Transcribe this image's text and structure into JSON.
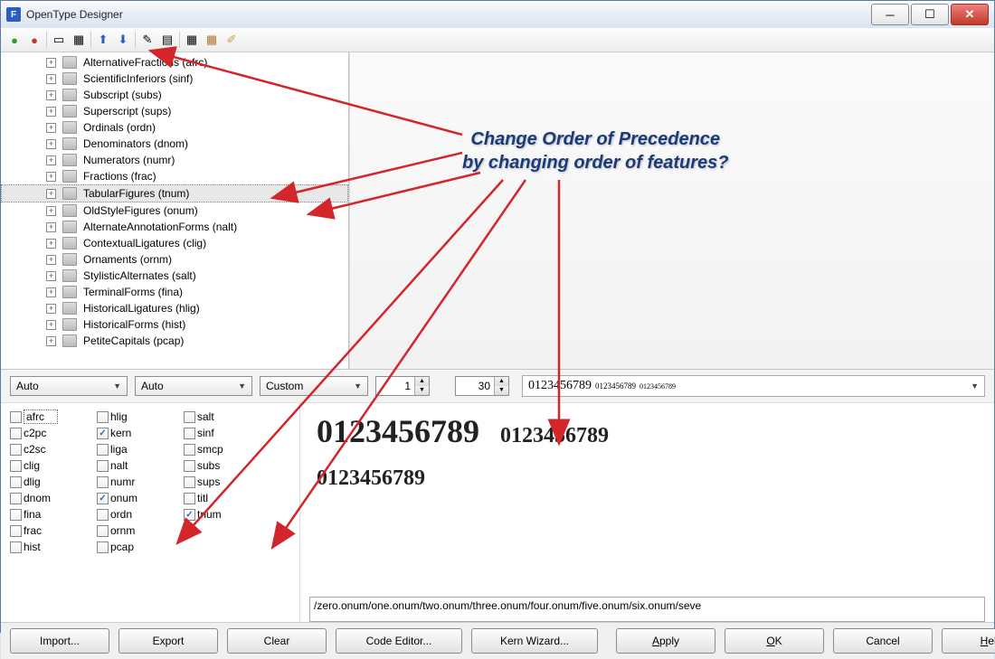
{
  "window": {
    "title": "OpenType Designer"
  },
  "tree": [
    {
      "label": "AlternativeFractions (afrc)",
      "sel": false
    },
    {
      "label": "ScientificInferiors (sinf)",
      "sel": false
    },
    {
      "label": "Subscript (subs)",
      "sel": false
    },
    {
      "label": "Superscript (sups)",
      "sel": false
    },
    {
      "label": "Ordinals (ordn)",
      "sel": false
    },
    {
      "label": "Denominators (dnom)",
      "sel": false
    },
    {
      "label": "Numerators (numr)",
      "sel": false
    },
    {
      "label": "Fractions (frac)",
      "sel": false
    },
    {
      "label": "TabularFigures (tnum)",
      "sel": true
    },
    {
      "label": "OldStyleFigures (onum)",
      "sel": false
    },
    {
      "label": "AlternateAnnotationForms (nalt)",
      "sel": false
    },
    {
      "label": "ContextualLigatures (clig)",
      "sel": false
    },
    {
      "label": "Ornaments (ornm)",
      "sel": false
    },
    {
      "label": "StylisticAlternates (salt)",
      "sel": false
    },
    {
      "label": "TerminalForms (fina)",
      "sel": false
    },
    {
      "label": "HistoricalLigatures (hlig)",
      "sel": false
    },
    {
      "label": "HistoricalForms (hist)",
      "sel": false
    },
    {
      "label": "PetiteCapitals (pcap)",
      "sel": false
    }
  ],
  "mid": {
    "combo1": "Auto",
    "combo2": "Auto",
    "combo3": "Custom",
    "spin1": "1",
    "spin2": "30",
    "previewline": {
      "big": "0123456789",
      "s1": "0123456789",
      "s2": "0123456789"
    }
  },
  "chkgrid": [
    [
      {
        "t": "afrc",
        "on": false,
        "focus": true
      },
      {
        "t": "hlig",
        "on": false
      },
      {
        "t": "salt",
        "on": false
      }
    ],
    [
      {
        "t": "c2pc",
        "on": false
      },
      {
        "t": "kern",
        "on": true
      },
      {
        "t": "sinf",
        "on": false
      }
    ],
    [
      {
        "t": "c2sc",
        "on": false
      },
      {
        "t": "liga",
        "on": false
      },
      {
        "t": "smcp",
        "on": false
      }
    ],
    [
      {
        "t": "clig",
        "on": false
      },
      {
        "t": "nalt",
        "on": false
      },
      {
        "t": "subs",
        "on": false
      }
    ],
    [
      {
        "t": "dlig",
        "on": false
      },
      {
        "t": "numr",
        "on": false
      },
      {
        "t": "sups",
        "on": false
      }
    ],
    [
      {
        "t": "dnom",
        "on": false
      },
      {
        "t": "onum",
        "on": true
      },
      {
        "t": "titl",
        "on": false
      }
    ],
    [
      {
        "t": "fina",
        "on": false
      },
      {
        "t": "ordn",
        "on": false
      },
      {
        "t": "tnum",
        "on": true
      }
    ],
    [
      {
        "t": "frac",
        "on": false
      },
      {
        "t": "ornm",
        "on": false
      },
      {
        "t": "",
        "on": false,
        "empty": true
      }
    ],
    [
      {
        "t": "hist",
        "on": false
      },
      {
        "t": "pcap",
        "on": false
      },
      {
        "t": "",
        "on": false,
        "empty": true
      }
    ]
  ],
  "preview": {
    "line1a": "0123456789",
    "line1b": "0123456789",
    "line2": "0123456789",
    "glyphs": "/zero.onum/one.onum/two.onum/three.onum/four.onum/five.onum/six.onum/seve"
  },
  "buttons": {
    "import": "Import...",
    "export": "Export",
    "clear": "Clear",
    "code": "Code Editor...",
    "kern": "Kern Wizard...",
    "apply": "Apply",
    "ok": "OK",
    "cancel": "Cancel",
    "help": "Help"
  },
  "annotation": {
    "l1": "Change Order of Precedence",
    "l2": "by changing order of features?"
  }
}
